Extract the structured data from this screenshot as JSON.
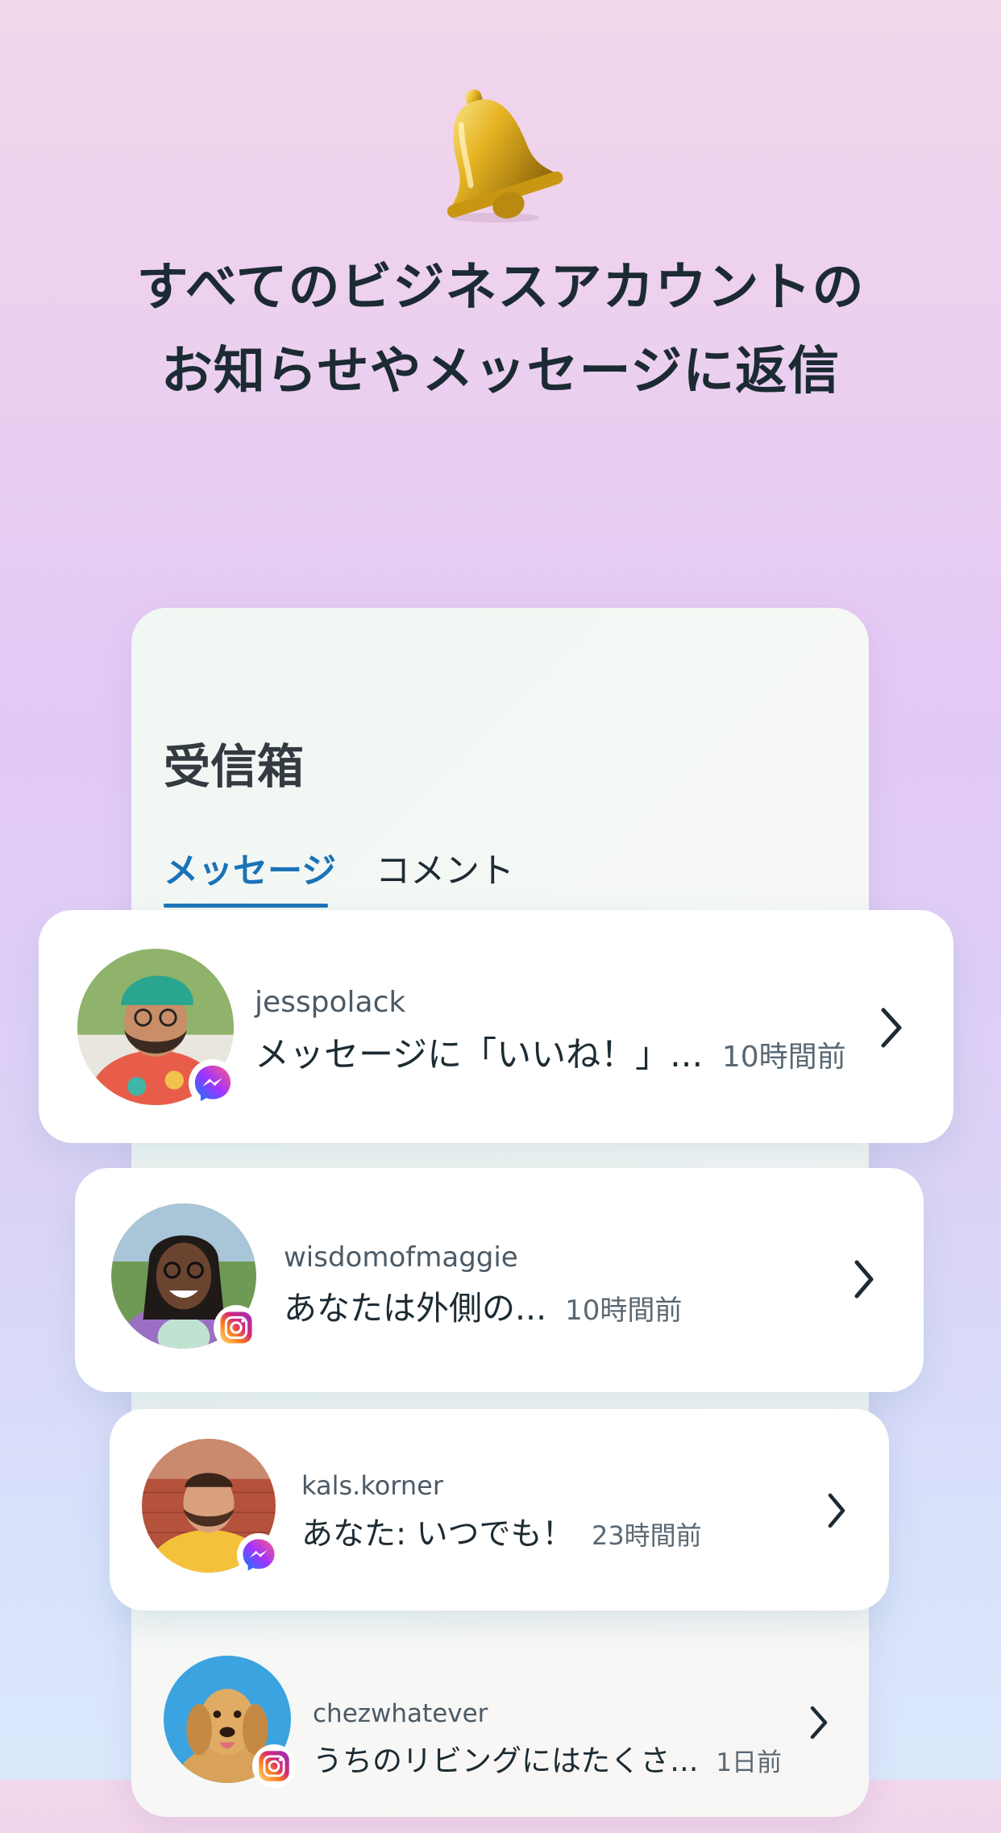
{
  "header": {
    "icon": "bell-icon",
    "headline_line1": "すべてのビジネスアカウントの",
    "headline_line2": "お知らせやメッセージに返信"
  },
  "inbox": {
    "title": "受信箱",
    "tabs": [
      {
        "label": "メッセージ",
        "selected": true
      },
      {
        "label": "コメント",
        "selected": false
      }
    ],
    "accent_color": "#1a73b8"
  },
  "conversations": [
    {
      "username": "jesspolack",
      "message": "メッセージに「いいね！」...",
      "time": "10時間前",
      "platform": "messenger-icon"
    },
    {
      "username": "wisdomofmaggie",
      "message": "あなたは外側の...",
      "time": "10時間前",
      "platform": "instagram-icon"
    },
    {
      "username": "kals.korner",
      "message": "あなた: いつでも！",
      "time": "23時間前",
      "platform": "messenger-icon"
    },
    {
      "username": "chezwhatever",
      "message": "うちのリビングにはたくさ...",
      "time": "1日前",
      "platform": "instagram-icon"
    }
  ]
}
